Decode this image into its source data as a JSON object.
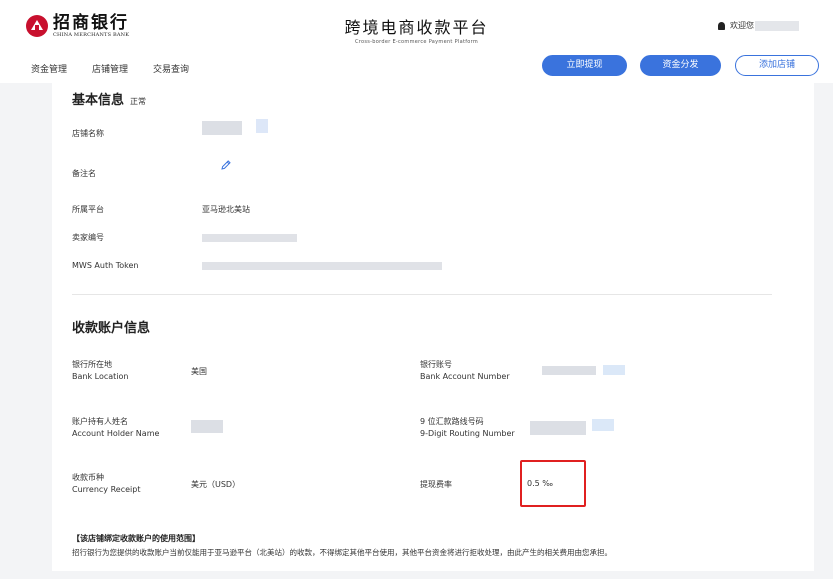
{
  "header": {
    "logo_cn": "招商银行",
    "logo_en": "CHINA MERCHANTS BANK",
    "platform_cn": "跨境电商收款平台",
    "platform_en": "Cross-border E-commerce Payment Platform",
    "welcome": "欢迎您"
  },
  "nav": [
    "资金管理",
    "店铺管理",
    "交易查询"
  ],
  "actions": {
    "withdraw": "立即提现",
    "distribute": "资金分发",
    "add_store": "添加店铺"
  },
  "basic_info": {
    "title": "基本信息",
    "status": "正常",
    "store_name_label": "店铺名称",
    "remark_label": "备注名",
    "platform_label": "所属平台",
    "platform_value": "亚马逊北美站",
    "seller_id_label": "卖家编号",
    "mws_label": "MWS Auth Token"
  },
  "account_info": {
    "title": "收款账户信息",
    "bank_location_cn": "银行所在地",
    "bank_location_en": "Bank Location",
    "bank_location_value": "美国",
    "bank_account_cn": "银行账号",
    "bank_account_en": "Bank Account Number",
    "holder_cn": "账户持有人姓名",
    "holder_en": "Account Holder Name",
    "routing_cn": "9 位汇款路线号码",
    "routing_en": "9-Digit Routing Number",
    "currency_cn": "收款币种",
    "currency_en": "Currency Receipt",
    "currency_value": "美元（USD）",
    "fee_label": "提现费率",
    "fee_value": "0.5 ‰"
  },
  "notice": {
    "title": "【该店铺绑定收款账户的使用范围】",
    "text": "招行银行为您提供的收款账户当前仅能用于亚马逊平台（北美站）的收款，不得绑定其他平台使用，其他平台资金将进行拒收处理，由此产生的相关费用由您承担。"
  },
  "colors": {
    "brand_red": "#c8102e",
    "primary_blue": "#3a73dd",
    "highlight_red": "#e02020"
  }
}
